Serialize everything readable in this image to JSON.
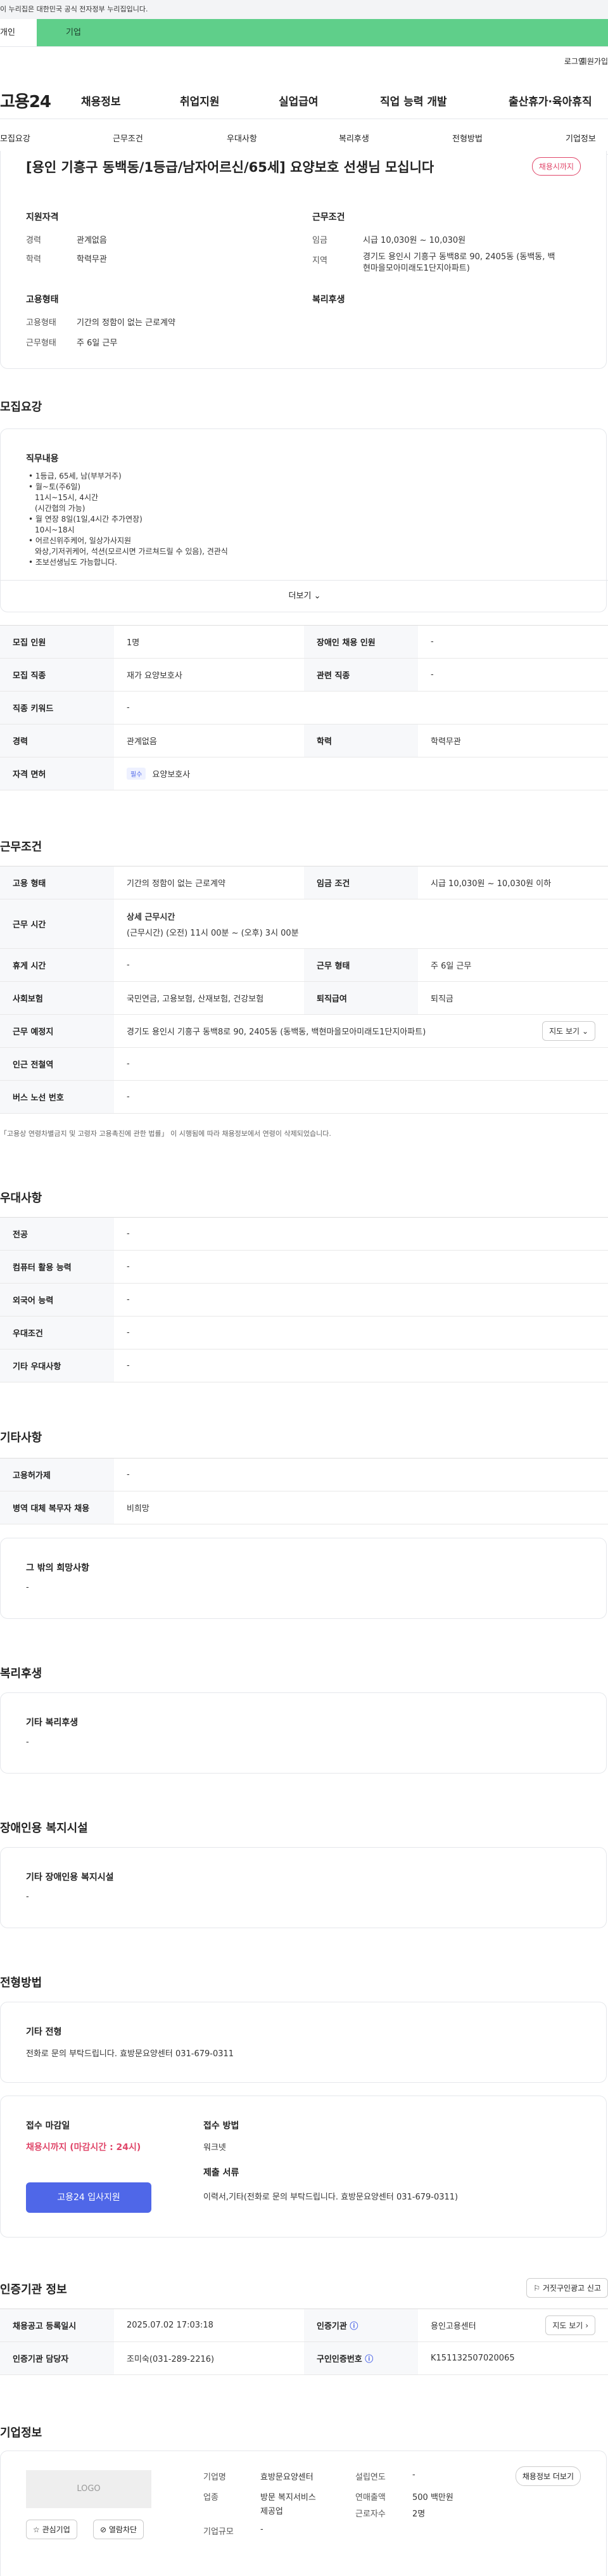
{
  "banner": "이 누리집은 대한민국 공식 전자정부 누리집입니다.",
  "site_tabs": [
    "개인",
    "기업"
  ],
  "top": {
    "login": "로그인",
    "join": "회원가입"
  },
  "gnb": {
    "logo": "고용24",
    "menu": [
      "채용정보",
      "취업지원",
      "실업급여",
      "직업 능력 개발",
      "출산휴가·육아휴직"
    ]
  },
  "snb": [
    "모집요강",
    "근무조건",
    "우대사항",
    "복리후생",
    "전형방법",
    "기업정보"
  ],
  "header": {
    "title": "[용인 기흥구 동백동/1등급/남자어르신/65세] 요양보호 선생님 모십니다",
    "badge": "채용시까지",
    "qual_title": "지원자격",
    "career_l": "경력",
    "career_v": "관계없음",
    "edu_l": "학력",
    "edu_v": "학력무관",
    "cond_title": "근무조건",
    "wage_l": "임금",
    "wage_v": "시급 10,030원 ~ 10,030원",
    "area_l": "지역",
    "area_v1": "경기도 용인시 기흥구 동백8로 90, 2405동 (동백동, 백",
    "area_v2": "현마을모아미래도1단지아파트)",
    "emp_title": "고용형태",
    "emp_l": "고용형태",
    "emp_v": "기간의 정함이 없는 근로계약",
    "work_l": "근무형태",
    "work_v": "주 6일 근무",
    "welfare_title": "복리후생"
  },
  "recruit": {
    "title": "모집요강",
    "job_title": "직무내용",
    "lines": [
      "• 1등급, 65세, 남(부부거주)",
      "• 월~토(주6일)",
      "  11시~15시, 4시간",
      "  (시간협의 가능)",
      "• 월 연장 8일(1일,4시간 추가연장)",
      "  10시~18시",
      "• 어르신위주케어, 일상가사지원",
      "  와상,기저귀케어, 석션(모르시면 가르쳐드릴 수 있음), 견관식",
      "• 조보선생님도 가능합니다."
    ],
    "more": "더보기",
    "rows": [
      [
        "모집 인원",
        "1명",
        "장애인 채용 인원",
        "-"
      ],
      [
        "모집 직종",
        "재가 요양보호사",
        "관련 직종",
        "-"
      ],
      [
        "직종 키워드",
        "-"
      ],
      [
        "경력",
        "관계없음",
        "학력",
        "학력무관"
      ],
      [
        "자격 면허",
        "필수",
        "요양보호사"
      ]
    ]
  },
  "work": {
    "title": "근무조건",
    "rows": [
      [
        "고용 형태",
        "기간의 정함이 없는 근로계약",
        "임금 조건",
        "시급 10,030원 ~ 10,030원 이하"
      ],
      [
        "근무 시간",
        "상세 근무시간",
        "(근무시간) (오전) 11시 00분 ~ (오후) 3시 00분"
      ],
      [
        "휴게 시간",
        "-",
        "근무 형태",
        "주 6일 근무"
      ],
      [
        "사회보험",
        "국민연금, 고용보험, 산재보험, 건강보험",
        "퇴직급여",
        "퇴직금"
      ],
      [
        "근무 예정지",
        "경기도 용인시 기흥구 동백8로 90, 2405동 (동백동, 백현마을모아미래도1단지아파트)",
        "지도 보기"
      ],
      [
        "인근 전철역",
        "-"
      ],
      [
        "버스 노선 번호",
        "-"
      ]
    ],
    "note": "「고용상 연령차별금지 및 고령자 고용촉진에 관한 법률」 이 시행됨에 따라 채용정보에서 연령이 삭제되었습니다."
  },
  "pref": {
    "title": "우대사항",
    "rows": [
      [
        "전공",
        "-"
      ],
      [
        "컴퓨터 활용 능력",
        "-"
      ],
      [
        "외국어 능력",
        "-"
      ],
      [
        "우대조건",
        "-"
      ],
      [
        "기타 우대사항",
        "-"
      ]
    ]
  },
  "other": {
    "title": "기타사항",
    "rows": [
      [
        "고용허가제",
        "-"
      ],
      [
        "병역 대체 복무자 채용",
        "비희망"
      ]
    ],
    "hope_title": "그 밖의 희망사항",
    "hope_v": "-"
  },
  "welfare": {
    "title": "복리후생",
    "sub": "기타 복리후생",
    "v": "-"
  },
  "disab": {
    "title": "장애인용 복지시설",
    "sub": "기타 장애인용 복지시설",
    "v": "-"
  },
  "method": {
    "title": "전형방법",
    "sub": "기타 전형",
    "v": "전화로 문의 부탁드립니다. 효방문요양센터 031-679-0311",
    "deadline_l": "접수 마감일",
    "deadline_v": "채용시까지 (마감시간 : 24시)",
    "apply_btn": "고용24 입사지원",
    "way_l": "접수 방법",
    "way_v": "워크넷",
    "docs_l": "제출 서류",
    "docs_v": "이력서,기타(전화로 문의 부탁드립니다. 효방문요양센터 031-679-0311)"
  },
  "cert": {
    "title": "인증기관 정보",
    "fake_btn": "거짓구인광고 신고",
    "rows": [
      [
        "채용공고 등록일시",
        "2025.07.02 17:03:18",
        "인증기관",
        "용인고용센터",
        "지도 보기"
      ],
      [
        "인증기관 담당자",
        "조미숙(031-289-2216)",
        "구인인증번호",
        "K151132507020065"
      ]
    ]
  },
  "company": {
    "title": "기업정보",
    "logo": "LOGO",
    "fav": "관심기업",
    "block": "열람차단",
    "name_l": "기업명",
    "name_v": "효방문요양센터",
    "found_l": "설립연도",
    "found_v": "-",
    "ind_l": "업종",
    "ind_v1": "방문 복지서비스",
    "ind_v2": "제공업",
    "sales_l": "연매출액",
    "sales_v": "500 백만원",
    "emp_l": "근로자수",
    "emp_v": "2명",
    "scale_l": "기업규모",
    "scale_v": "-",
    "list_btn": "채용정보 더보기"
  }
}
